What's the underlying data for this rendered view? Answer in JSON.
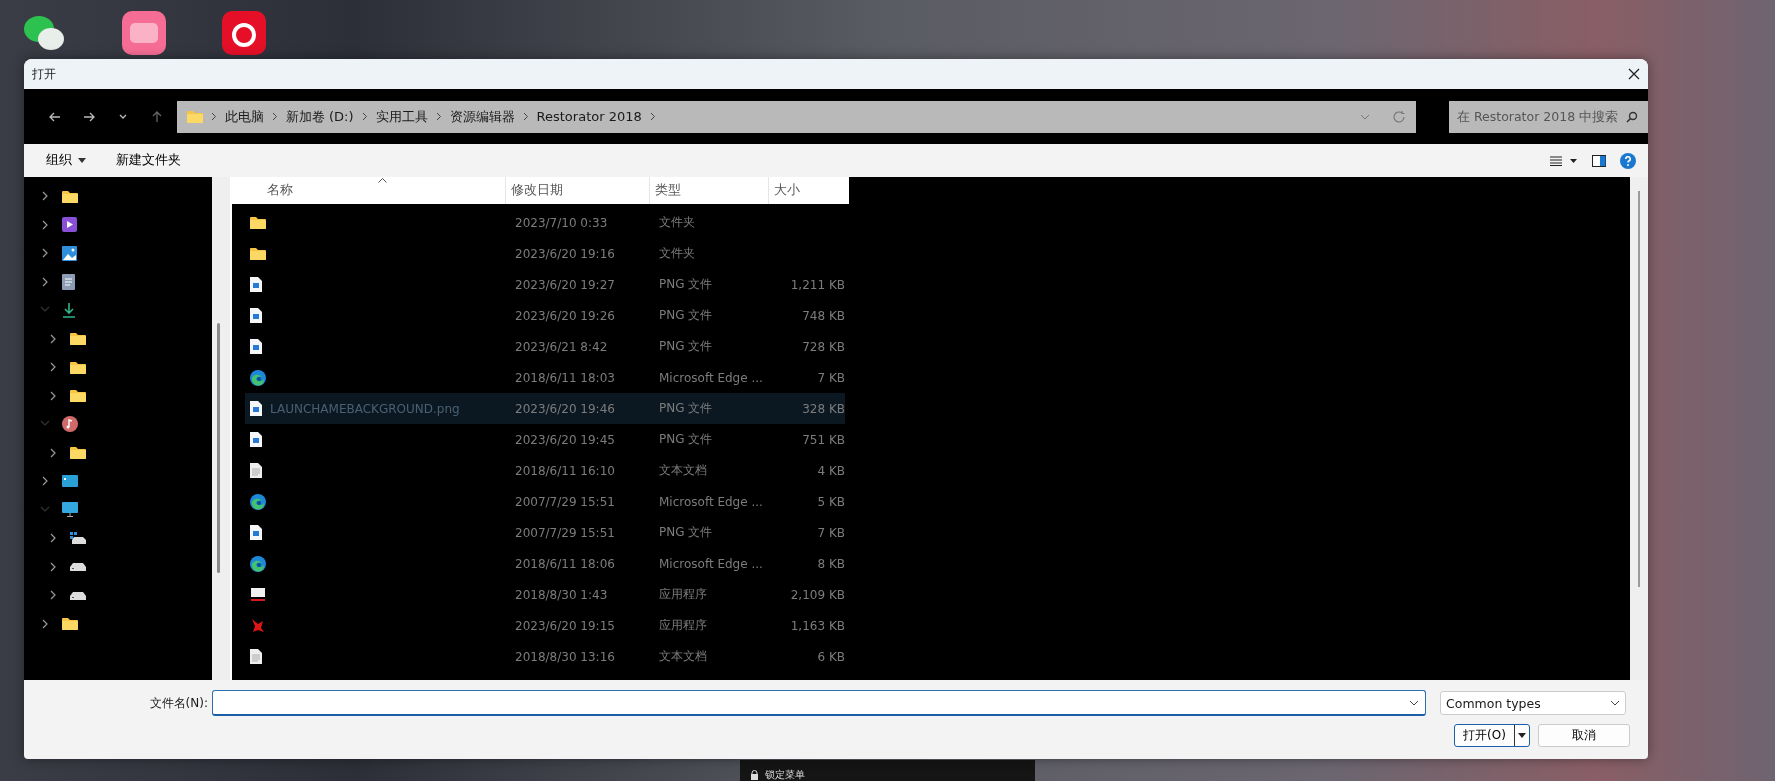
{
  "desktop": {
    "icons": [
      {
        "kind": "chat"
      },
      {
        "kind": "pink"
      },
      {
        "kind": "music-red"
      }
    ],
    "taskbar_text": "锁定菜单"
  },
  "window": {
    "title": "打开"
  },
  "nav": {
    "breadcrumbs": [
      "此电脑",
      "新加卷 (D:)",
      "实用工具",
      "资源编辑器",
      "Restorator 2018"
    ],
    "search": {
      "placeholder": "在 Restorator 2018 中搜索"
    }
  },
  "toolbar": {
    "organize": "组织",
    "new_folder": "新建文件夹"
  },
  "sidebar": {
    "items": [
      {
        "kind": "folder",
        "expanded": false
      },
      {
        "kind": "video",
        "expanded": false
      },
      {
        "kind": "pictures",
        "expanded": false
      },
      {
        "kind": "documents",
        "expanded": false
      },
      {
        "kind": "downloads",
        "expanded": true,
        "children": [
          {
            "kind": "folder",
            "expanded": false
          },
          {
            "kind": "folder",
            "expanded": false
          },
          {
            "kind": "folder",
            "expanded": false
          }
        ]
      },
      {
        "kind": "music",
        "expanded": true,
        "children": [
          {
            "kind": "folder",
            "expanded": false
          }
        ]
      },
      {
        "kind": "device",
        "expanded": false
      },
      {
        "kind": "pc",
        "expanded": true,
        "children": [
          {
            "kind": "windrive",
            "expanded": false
          },
          {
            "kind": "drive",
            "expanded": false
          },
          {
            "kind": "drive",
            "expanded": false
          }
        ]
      },
      {
        "kind": "folder",
        "expanded": false
      }
    ]
  },
  "table": {
    "columns": [
      "名称",
      "修改日期",
      "类型",
      "大小"
    ],
    "rows": [
      {
        "kind": "folder",
        "date": "2023/7/10 0:33",
        "type": "文件夹",
        "selected": false
      },
      {
        "kind": "folder",
        "date": "2023/6/20 19:16",
        "type": "文件夹",
        "selected": false
      },
      {
        "kind": "png",
        "date": "2023/6/20 19:27",
        "type": "PNG 文件",
        "size": "1,211 KB",
        "selected": false
      },
      {
        "kind": "png",
        "date": "2023/6/20 19:26",
        "type": "PNG 文件",
        "size": "748 KB",
        "selected": false
      },
      {
        "kind": "png",
        "date": "2023/6/21 8:42",
        "type": "PNG 文件",
        "size": "728 KB",
        "selected": false
      },
      {
        "kind": "edge",
        "date": "2018/6/11 18:03",
        "type": "Microsoft Edge ...",
        "size": "7 KB",
        "selected": false
      },
      {
        "kind": "png",
        "name": "LAUNCHAMEBACKGROUND.png",
        "date": "2023/6/20 19:46",
        "type": "PNG 文件",
        "size": "328 KB",
        "selected": true
      },
      {
        "kind": "png",
        "date": "2023/6/20 19:45",
        "type": "PNG 文件",
        "size": "751 KB",
        "selected": false
      },
      {
        "kind": "text",
        "date": "2018/6/11 16:10",
        "type": "文本文档",
        "size": "4 KB",
        "selected": false
      },
      {
        "kind": "edge",
        "date": "2007/7/29 15:51",
        "type": "Microsoft Edge ...",
        "size": "5 KB",
        "selected": false
      },
      {
        "kind": "png",
        "date": "2007/7/29 15:51",
        "type": "PNG 文件",
        "size": "7 KB",
        "selected": false
      },
      {
        "kind": "edge",
        "date": "2018/6/11 18:06",
        "type": "Microsoft Edge ...",
        "size": "8 KB",
        "selected": false
      },
      {
        "kind": "res",
        "date": "2018/8/30 1:43",
        "type": "应用程序",
        "size": "2,109 KB",
        "selected": false
      },
      {
        "kind": "app",
        "date": "2023/6/20 19:15",
        "type": "应用程序",
        "size": "1,163 KB",
        "selected": false
      },
      {
        "kind": "text",
        "date": "2018/8/30 13:16",
        "type": "文本文档",
        "size": "6 KB",
        "selected": false
      }
    ]
  },
  "footer": {
    "filename_label": "文件名(N):",
    "filter": "Common types",
    "open": "打开(O)",
    "cancel": "取消"
  }
}
